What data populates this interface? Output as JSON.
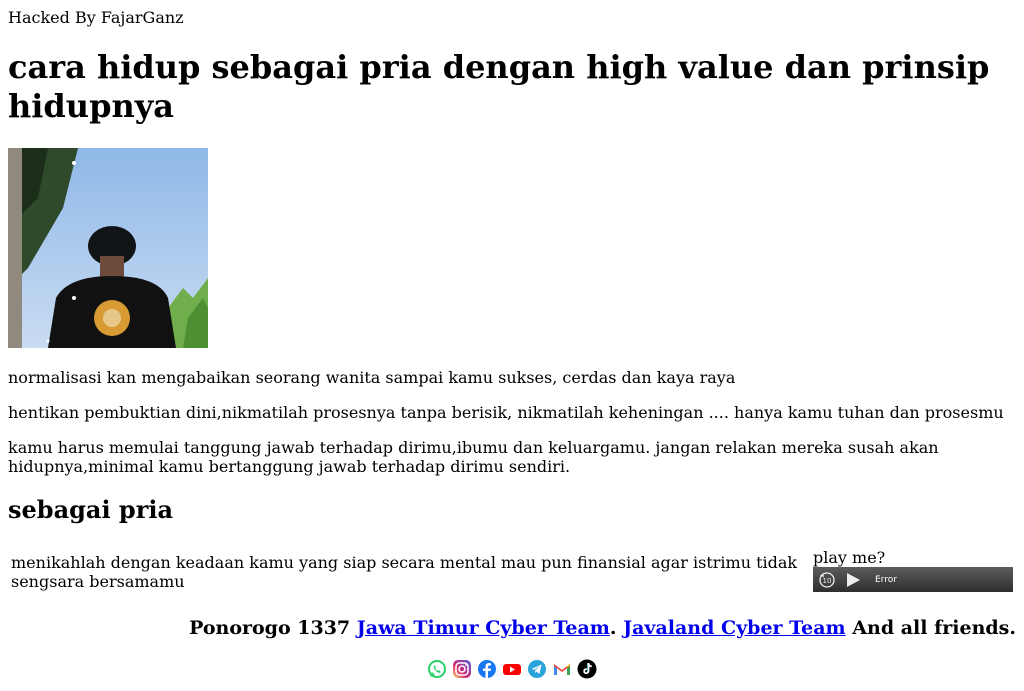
{
  "header": {
    "hacked_by": "Hacked By FajarGanz"
  },
  "title": "cara hidup sebagai pria dengan high value dan prinsip hidupnya",
  "paragraphs": [
    "normalisasi kan mengabaikan seorang wanita sampai kamu sukses, cerdas dan kaya raya",
    "hentikan pembuktian dini,nikmatilah prosesnya tanpa berisik, nikmatilah keheningan .... hanya kamu tuhan dan prosesmu",
    "kamu harus memulai tanggung jawab terhadap dirimu,ibumu dan keluargamu. jangan relakan mereka susah akan hidupnya,minimal kamu bertanggung jawab terhadap dirimu sendiri."
  ],
  "section_heading": "sebagai pria",
  "section_text": "menikahlah dengan keadaan kamu yang siap secara mental mau pun finansial agar istrimu tidak sengsara bersamamu",
  "audio": {
    "label": "play me?",
    "status": "Error"
  },
  "footer": {
    "prefix": "Ponorogo 1337",
    "link1": "Jawa Timur Cyber Team",
    "separator": ".",
    "link2": "Javaland Cyber Team",
    "suffix": "And all friends."
  },
  "social_icons": [
    "whatsapp-icon",
    "instagram-icon",
    "facebook-icon",
    "youtube-icon",
    "telegram-icon",
    "gmail-icon",
    "tiktok-icon"
  ],
  "colors": {
    "link": "#0000ee",
    "whatsapp": "#25d366",
    "facebook": "#1877f2",
    "youtube": "#ff0000",
    "telegram": "#2aa3db"
  }
}
